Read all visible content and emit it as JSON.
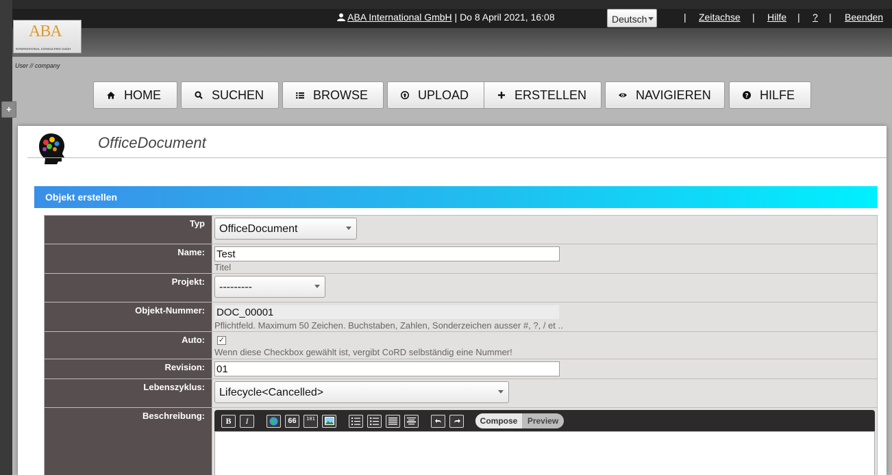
{
  "header": {
    "logo": "ABA",
    "logo_sub": "INTERNATIONAL CONSULTING GmbH",
    "company": "ABA International GmbH",
    "datetime": "| Do 8 April 2021, 16:08",
    "language": "Deutsch",
    "links": [
      "Zeitachse",
      "Hilfe",
      "?",
      "Beenden"
    ],
    "separator": "|"
  },
  "breadcrumb": "User // company",
  "sidebar_toggle": "+",
  "nav": {
    "home": "HOME",
    "search": "SUCHEN",
    "browse": "BROWSE",
    "upload": "UPLOAD",
    "create": "ERSTELLEN",
    "navigate": "NAVIGIEREN",
    "help": "HILFE"
  },
  "panel": {
    "title": "OfficeDocument",
    "section": "Objekt erstellen"
  },
  "form": {
    "type_label": "Typ",
    "type_value": "OfficeDocument",
    "name_label": "Name:",
    "name_value": "Test",
    "name_help": "Titel",
    "project_label": "Projekt:",
    "project_value": "---------",
    "number_label": "Objekt-Nummer:",
    "number_value": "DOC_00001",
    "number_help": "Pflichtfeld. Maximum 50 Zeichen. Buchstaben, Zahlen, Sonderzeichen ausser #, ?, / et ..",
    "auto_label": "Auto:",
    "auto_help": "Wenn diese Checkbox gewählt ist, vergibt CoRD selbständig eine Nummer!",
    "revision_label": "Revision:",
    "revision_value": "01",
    "lifecycle_label": "Lebenszyklus:",
    "lifecycle_value": "Lifecycle<Cancelled>",
    "description_label": "Beschreibung:"
  },
  "editor": {
    "bold": "B",
    "italic": "I",
    "quote": "66",
    "code": "101",
    "compose": "Compose",
    "preview": "Preview"
  }
}
